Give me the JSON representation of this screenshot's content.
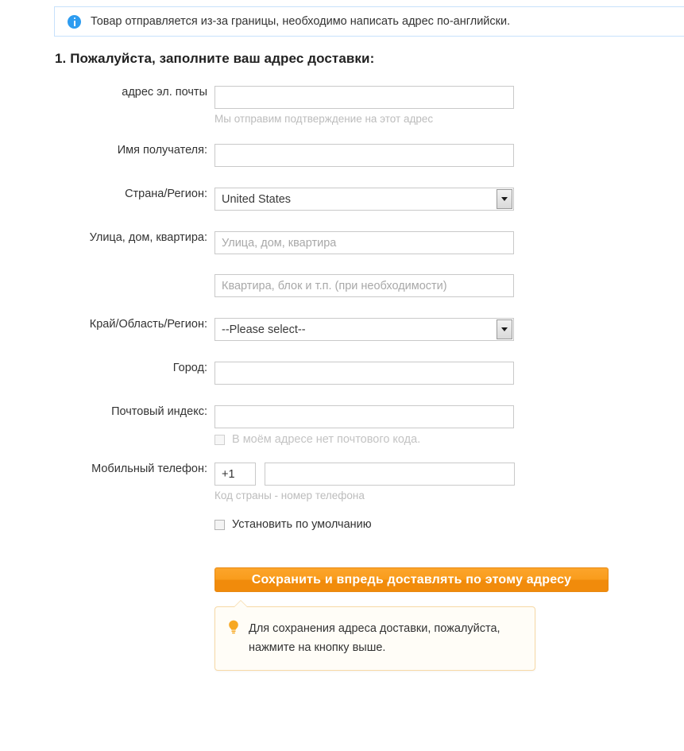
{
  "alert": {
    "icon": "info-circle-icon",
    "message": "Товар отправляется из-за границы, необходимо написать адрес по-английски."
  },
  "heading": "1. Пожалуйста, заполните ваш адрес доставки:",
  "form": {
    "email": {
      "label": "адрес эл. почты",
      "value": "",
      "placeholder": "",
      "hint": "Мы отправим подтверждение на этот адрес"
    },
    "recipient": {
      "label": "Имя получателя:",
      "value": "",
      "placeholder": ""
    },
    "country": {
      "label": "Страна/Регион:",
      "value": "United States",
      "caret": "chevron-down-icon"
    },
    "street": {
      "label": "Улица, дом, квартира:",
      "value": "",
      "placeholder": "Улица, дом, квартира"
    },
    "apartment": {
      "label": "",
      "value": "",
      "placeholder": "Квартира, блок и т.п. (при необходимости)"
    },
    "state": {
      "label": "Край/Область/Регион:",
      "value": "--Please select--",
      "caret": "chevron-down-icon"
    },
    "city": {
      "label": "Город:",
      "value": "",
      "placeholder": ""
    },
    "postal": {
      "label": "Почтовый индекс:",
      "value": "",
      "placeholder": "",
      "no_postal_checkbox": {
        "label": "В моём адресе нет почтового кода.",
        "checked": false,
        "disabled": true
      }
    },
    "phone": {
      "label": "Мобильный телефон:",
      "country_code": "+1",
      "number": "",
      "number_placeholder": "",
      "hint": "Код страны - номер телефона"
    },
    "default_checkbox": {
      "label": "Установить по умолчанию",
      "checked": false
    }
  },
  "save_button": {
    "label": "Сохранить и впредь доставлять по этому адресу"
  },
  "callout": {
    "icon": "lightbulb-icon",
    "line1": "Для сохранения адреса доставки, пожалуйста,",
    "line2": "нажмите на кнопку выше."
  },
  "colors": {
    "alert_border": "#c7e1fb",
    "info_icon": "#2d9cf0",
    "button_orange": "#f99c1c",
    "button_border": "#e88a14",
    "callout_border": "#f7d9a6",
    "callout_bg": "#fffdf7",
    "bulb_orange": "#f7a823",
    "input_border": "#c9c9c9",
    "placeholder": "#a8a8a8",
    "hint_gray": "#bcbcbc"
  }
}
